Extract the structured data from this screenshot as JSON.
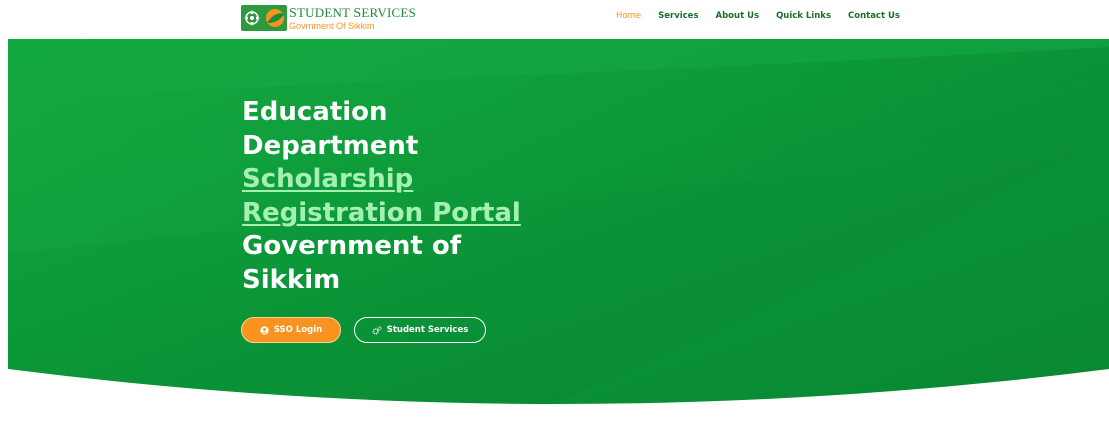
{
  "header": {
    "logo": {
      "title_first_big": "S",
      "title_first_rest": "TUDENT ",
      "title_second_big": "S",
      "title_second_rest": "ERVICES",
      "subtitle": "Govrnment Of Sikkim"
    },
    "nav": [
      {
        "label": "Home",
        "active": true
      },
      {
        "label": "Services",
        "active": false
      },
      {
        "label": "About Us",
        "active": false
      },
      {
        "label": "Quick Links",
        "active": false
      },
      {
        "label": "Contact Us",
        "active": false
      }
    ]
  },
  "hero": {
    "line1": "Education",
    "line2": "Department",
    "link_line1": "Scholarship",
    "link_line2": "Registration Portal",
    "line5": "Government of",
    "line6": "Sikkim",
    "buttons": {
      "sso_login": "SSO Login",
      "student_services": "Student Services"
    }
  },
  "colors": {
    "brand_green": "#1a8b3c",
    "hero_green": "#0d9a3a",
    "accent_orange": "#f7931e",
    "link_green": "#a6f0b4"
  },
  "icons": {
    "sso_login": "user-circle-icon",
    "student_services": "gears-icon"
  }
}
